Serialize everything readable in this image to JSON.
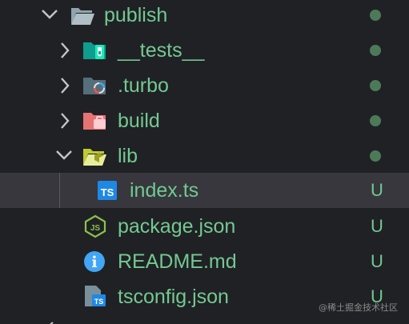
{
  "explorer": {
    "folder": {
      "name": "publish",
      "chevron": "chevron-down-icon",
      "icon": "folder-open-icon"
    },
    "items": [
      {
        "name": "__tests__",
        "kind": "folder",
        "icon": "folder-tests-icon",
        "status": "modified-dot"
      },
      {
        "name": ".turbo",
        "kind": "folder",
        "icon": "folder-turbo-icon",
        "status": "modified-dot"
      },
      {
        "name": "build",
        "kind": "folder",
        "icon": "folder-build-icon",
        "status": "modified-dot"
      },
      {
        "name": "lib",
        "kind": "folder",
        "icon": "folder-lib-open-icon",
        "status": "modified-dot",
        "expanded": true
      },
      {
        "name": "index.ts",
        "kind": "file",
        "icon": "typescript-icon",
        "status": "U",
        "selected": true
      },
      {
        "name": "package.json",
        "kind": "file",
        "icon": "nodejs-icon",
        "status": "U"
      },
      {
        "name": "README.md",
        "kind": "file",
        "icon": "info-icon",
        "status": "U"
      },
      {
        "name": "tsconfig.json",
        "kind": "file",
        "icon": "tsconfig-icon",
        "status": "U"
      }
    ],
    "icon_glyphs": {
      "typescript": "TS",
      "nodejs": "JS",
      "info": "i",
      "tsconfig": "TS"
    }
  },
  "watermark": "@稀土掘金技术社区",
  "colors": {
    "background": "#202125",
    "selected_row": "#37373d",
    "untracked_text": "#73c991",
    "status_dot": "#4c7a58",
    "chevron": "#c5c5c5"
  }
}
